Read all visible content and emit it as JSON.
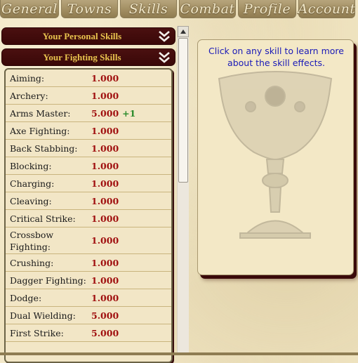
{
  "tabs": [
    "General",
    "Towns",
    "Skills",
    "Combat",
    "Profile",
    "Account"
  ],
  "sections": {
    "personal": "Your Personal Skills",
    "fighting": "Your Fighting Skills"
  },
  "skills": [
    {
      "name": "Aiming:",
      "value": "1.000",
      "bonus": ""
    },
    {
      "name": "Archery:",
      "value": "1.000",
      "bonus": ""
    },
    {
      "name": "Arms Master:",
      "value": "5.000",
      "bonus": "+1"
    },
    {
      "name": "Axe Fighting:",
      "value": "1.000",
      "bonus": ""
    },
    {
      "name": "Back Stabbing:",
      "value": "1.000",
      "bonus": ""
    },
    {
      "name": "Blocking:",
      "value": "1.000",
      "bonus": ""
    },
    {
      "name": "Charging:",
      "value": "1.000",
      "bonus": ""
    },
    {
      "name": "Cleaving:",
      "value": "1.000",
      "bonus": ""
    },
    {
      "name": "Critical Strike:",
      "value": "1.000",
      "bonus": ""
    },
    {
      "name": "Crossbow Fighting:",
      "value": "1.000",
      "bonus": ""
    },
    {
      "name": "Crushing:",
      "value": "1.000",
      "bonus": ""
    },
    {
      "name": "Dagger Fighting:",
      "value": "1.000",
      "bonus": ""
    },
    {
      "name": "Dodge:",
      "value": "1.000",
      "bonus": ""
    },
    {
      "name": "Dual Wielding:",
      "value": "5.000",
      "bonus": ""
    },
    {
      "name": "First Strike:",
      "value": "5.000",
      "bonus": ""
    }
  ],
  "info": {
    "text": "Click on any skill to learn more about the skill effects."
  },
  "colors": {
    "header_bg": "#3a0808",
    "header_text": "#e9c34e",
    "value_text": "#a01010",
    "bonus_text": "#2a8a2a",
    "info_text": "#1a1ab8"
  },
  "icons": {
    "collapse": "double-chevron-down-icon",
    "scroll_up": "arrow-up-icon",
    "decor": "goblet-icon"
  }
}
